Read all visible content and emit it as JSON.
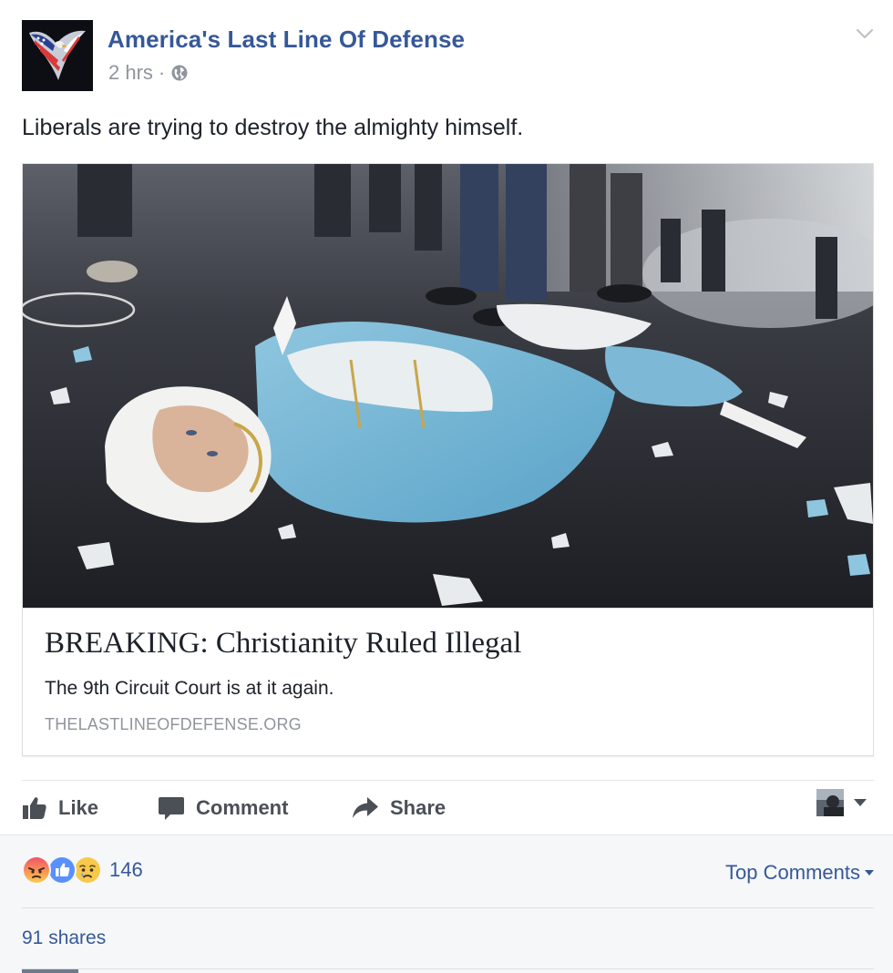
{
  "post": {
    "page_name": "America's Last Line Of Defense",
    "time_ago": "2 hrs",
    "separator": "·",
    "privacy_icon": "globe-icon",
    "text": "Liberals are trying to destroy the almighty himself."
  },
  "link_preview": {
    "title": "BREAKING: Christianity Ruled Illegal",
    "description": "The 9th Circuit Court is at it again.",
    "domain": "THELASTLINEOFDEFENSE.ORG",
    "image_icon": "broken-statue-photo"
  },
  "actions": {
    "like_label": "Like",
    "comment_label": "Comment",
    "share_label": "Share"
  },
  "footer": {
    "reaction_icons": [
      "angry-icon",
      "like-icon",
      "sad-icon"
    ],
    "reaction_count": "146",
    "top_comments_label": "Top Comments",
    "shares_label": "91 shares"
  },
  "colors": {
    "link_blue": "#365899",
    "muted_gray": "#90949c",
    "action_gray": "#4b4f56",
    "footer_bg": "#f6f7f9"
  }
}
